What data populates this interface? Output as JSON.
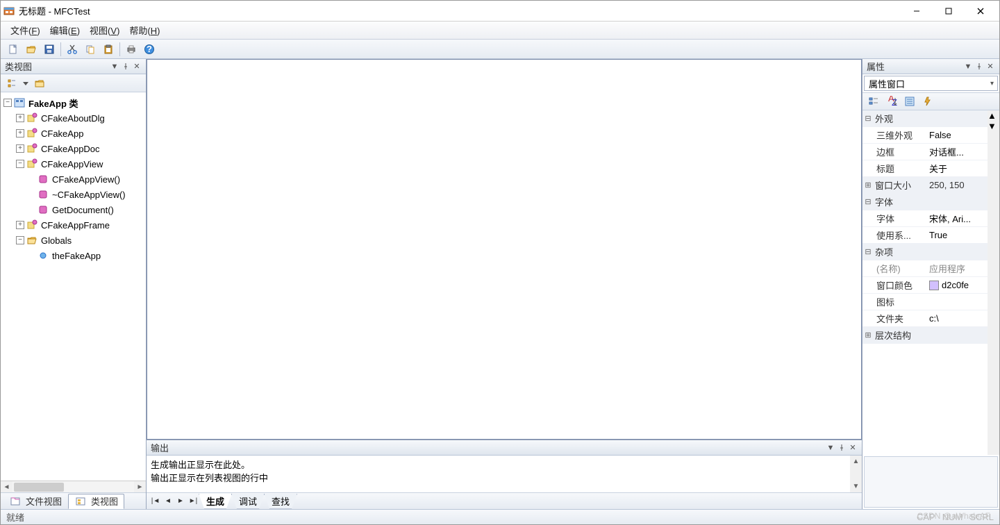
{
  "window": {
    "title": "无标题 - MFCTest"
  },
  "menu": {
    "file": {
      "label": "文件",
      "key": "F"
    },
    "edit": {
      "label": "编辑",
      "key": "E"
    },
    "view": {
      "label": "视图",
      "key": "V"
    },
    "help": {
      "label": "帮助",
      "key": "H"
    }
  },
  "left_panel": {
    "title": "类视图",
    "tabs": {
      "file_view": "文件视图",
      "class_view": "类视图"
    },
    "tree": {
      "root": "FakeApp 类",
      "n1": "CFakeAboutDlg",
      "n2": "CFakeApp",
      "n3": "CFakeAppDoc",
      "n4": "CFakeAppView",
      "n4a": "CFakeAppView()",
      "n4b": "~CFakeAppView()",
      "n4c": "GetDocument()",
      "n5": "CFakeAppFrame",
      "n6": "Globals",
      "n6a": "theFakeApp"
    }
  },
  "output": {
    "title": "输出",
    "lines": {
      "l1": "生成输出正显示在此处。",
      "l2": "输出正显示在列表视图的行中"
    },
    "tabs": {
      "build": "生成",
      "debug": "调试",
      "find": "查找"
    }
  },
  "props": {
    "title": "属性",
    "combo": "属性窗口",
    "cats": {
      "appearance": "外观",
      "winsize": "窗口大小",
      "font": "字体",
      "misc": "杂项",
      "hierarchy": "层次结构"
    },
    "rows": {
      "threeD": {
        "name": "三维外观",
        "value": "False"
      },
      "border": {
        "name": "边框",
        "value": "对话框..."
      },
      "caption": {
        "name": "标题",
        "value": "关于"
      },
      "winsize": {
        "name": "窗口大小",
        "value": "250, 150"
      },
      "font": {
        "name": "字体",
        "value": "宋体, Ari..."
      },
      "usesys": {
        "name": "使用系...",
        "value": "True"
      },
      "name": {
        "name": "(名称)",
        "value": "应用程序"
      },
      "wincolor": {
        "name": "窗口颜色",
        "value": "d2c0fe",
        "swatch": "#d2c0fe"
      },
      "icon": {
        "name": "图标",
        "value": ""
      },
      "folder": {
        "name": "文件夹",
        "value": "c:\\"
      }
    }
  },
  "status": {
    "ready": "就绪",
    "cap": "CAP",
    "num": "NUM",
    "scrl": "SCRL"
  },
  "watermark": "CSDN @aWhaleAF"
}
